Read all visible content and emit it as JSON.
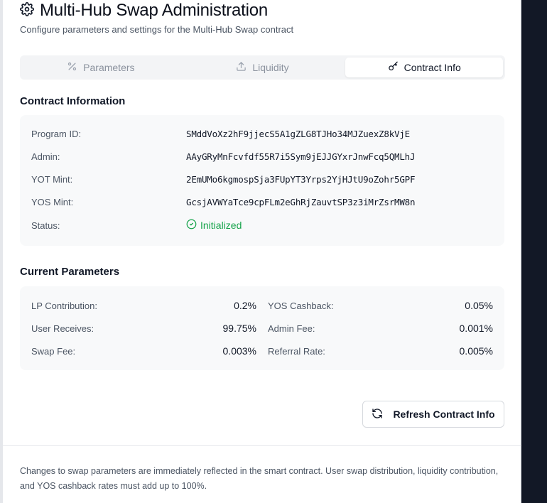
{
  "header": {
    "title": "Multi-Hub Swap Administration",
    "subtitle": "Configure parameters and settings for the Multi-Hub Swap contract",
    "icon": "gear-icon"
  },
  "tabs": [
    {
      "label": "Parameters",
      "icon": "percent-icon",
      "active": false
    },
    {
      "label": "Liquidity",
      "icon": "upload-icon",
      "active": false
    },
    {
      "label": "Contract Info",
      "icon": "key-icon",
      "active": true
    }
  ],
  "contract_info": {
    "title": "Contract Information",
    "rows": [
      {
        "label": "Program ID:",
        "value": "SMddVoXz2hF9jjecS5A1gZLG8TJHo34MJZuexZ8kVjE"
      },
      {
        "label": "Admin:",
        "value": "AAyGRyMnFcvfdf55R7i5Sym9jEJJGYxrJnwFcq5QMLhJ"
      },
      {
        "label": "YOT Mint:",
        "value": "2EmUMo6kgmospSja3FUpYT3Yrps2YjHJtU9oZohr5GPF"
      },
      {
        "label": "YOS Mint:",
        "value": "GcsjAVWYaTce9cpFLm2eGhRjZauvtSP3z3iMrZsrMW8n"
      }
    ],
    "status_label": "Status:",
    "status_value": "Initialized",
    "status_color": "#16a34a"
  },
  "parameters": {
    "title": "Current Parameters",
    "left": [
      {
        "label": "LP Contribution:",
        "value": "0.2%"
      },
      {
        "label": "User Receives:",
        "value": "99.75%"
      },
      {
        "label": "Swap Fee:",
        "value": "0.003%"
      }
    ],
    "right": [
      {
        "label": "YOS Cashback:",
        "value": "0.05%"
      },
      {
        "label": "Admin Fee:",
        "value": "0.001%"
      },
      {
        "label": "Referral Rate:",
        "value": "0.005%"
      }
    ]
  },
  "actions": {
    "refresh_label": "Refresh Contract Info"
  },
  "footer": {
    "note": "Changes to swap parameters are immediately reflected in the smart contract. User swap distribution, liquidity contribution, and YOS cashback rates must add up to 100%."
  }
}
